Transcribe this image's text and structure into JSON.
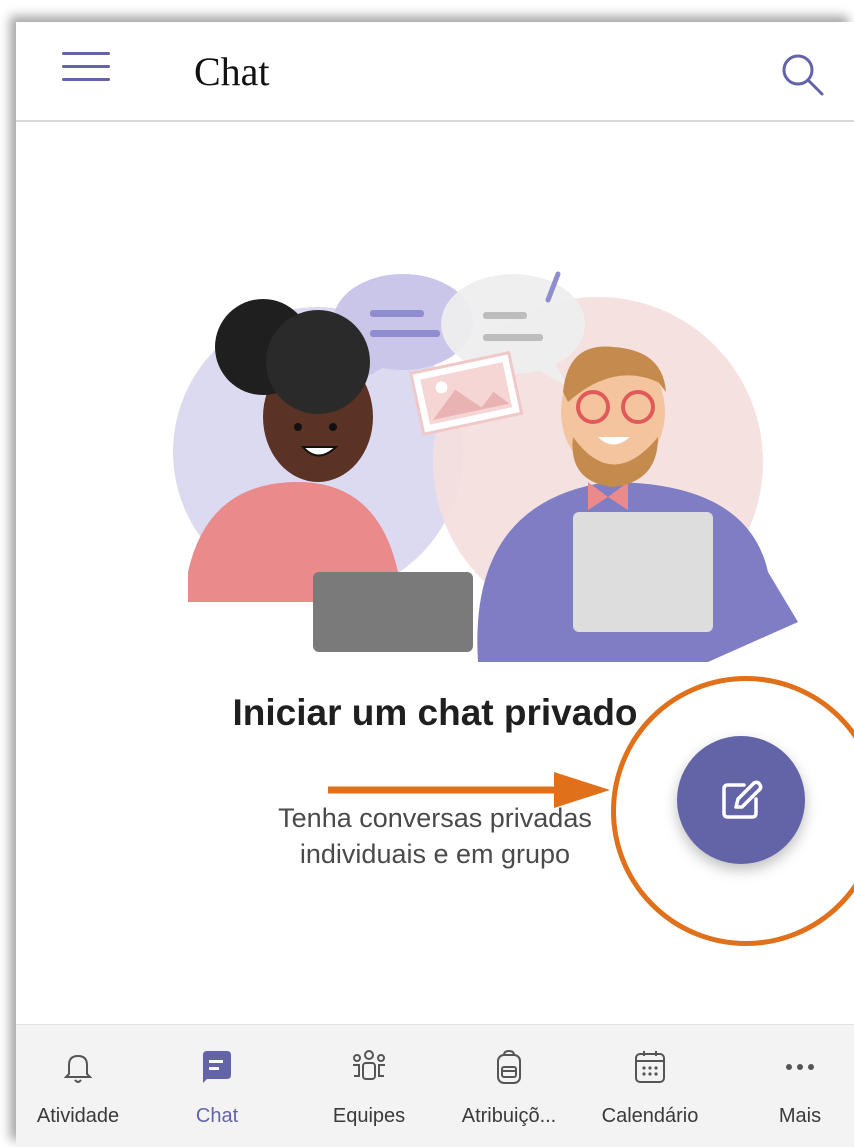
{
  "header": {
    "title": "Chat",
    "menu_icon": "hamburger-menu-icon",
    "search_icon": "search-icon"
  },
  "empty_state": {
    "heading": "Iniciar um chat privado",
    "description_line1": "Tenha conversas privadas",
    "description_line2": "individuais e em grupo"
  },
  "fab": {
    "icon": "compose-edit-icon"
  },
  "nav": {
    "items": [
      {
        "label": "Atividade",
        "icon": "bell-icon",
        "active": false
      },
      {
        "label": "Chat",
        "icon": "chat-icon",
        "active": true
      },
      {
        "label": "Equipes",
        "icon": "teams-icon",
        "active": false
      },
      {
        "label": "Atribuiçõ...",
        "icon": "backpack-icon",
        "active": false
      },
      {
        "label": "Calendário",
        "icon": "calendar-icon",
        "active": false
      },
      {
        "label": "Mais",
        "icon": "more-icon",
        "active": false
      }
    ]
  },
  "colors": {
    "accent": "#6264a7",
    "annotation": "#e0701a",
    "text_primary": "#1f1f1f"
  }
}
